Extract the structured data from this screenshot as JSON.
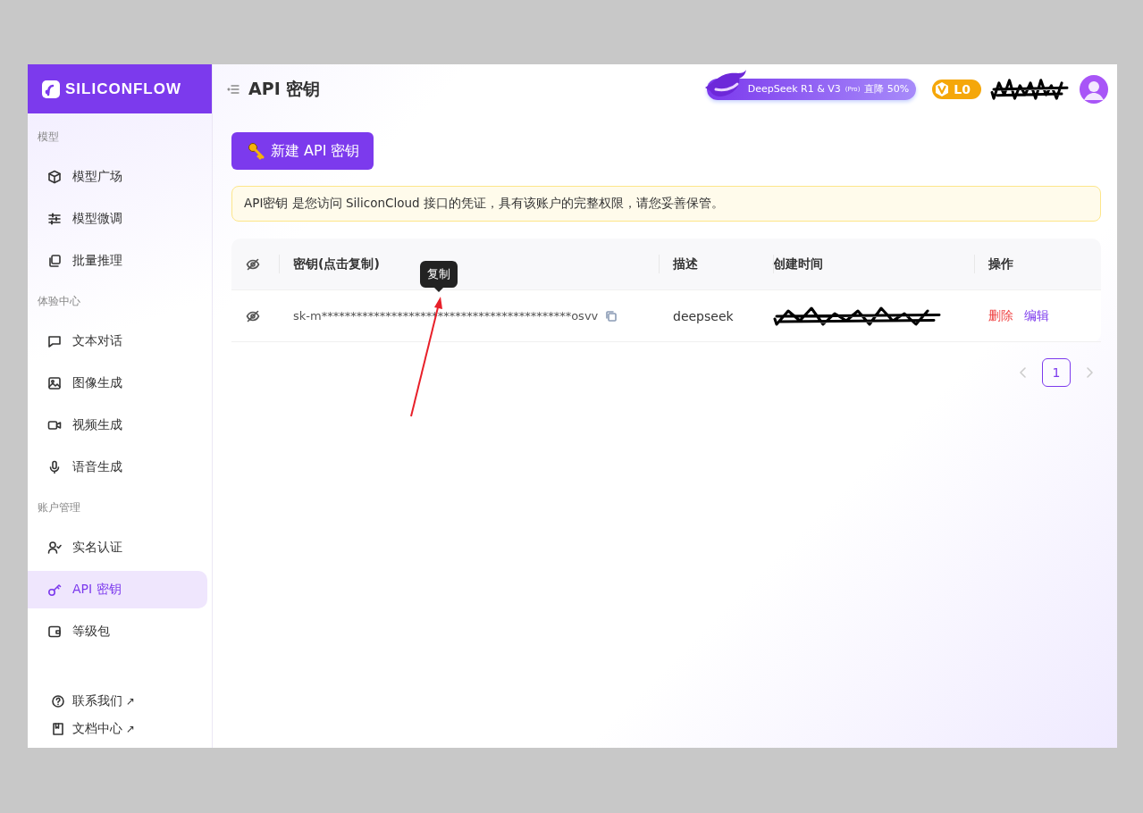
{
  "brand": {
    "name": "SILICONFLOW"
  },
  "sidebar": {
    "sections": [
      {
        "title": "模型",
        "items": [
          {
            "label": "模型广场",
            "selected": false
          },
          {
            "label": "模型微调",
            "selected": false
          },
          {
            "label": "批量推理",
            "selected": false
          }
        ]
      },
      {
        "title": "体验中心",
        "items": [
          {
            "label": "文本对话",
            "selected": false
          },
          {
            "label": "图像生成",
            "selected": false
          },
          {
            "label": "视频生成",
            "selected": false
          },
          {
            "label": "语音生成",
            "selected": false
          }
        ]
      },
      {
        "title": "账户管理",
        "items": [
          {
            "label": "实名认证",
            "selected": false
          },
          {
            "label": "API 密钥",
            "selected": true
          },
          {
            "label": "等级包",
            "selected": false
          }
        ]
      }
    ],
    "footer_links": [
      {
        "label": "联系我们",
        "arrow": "↗"
      },
      {
        "label": "文档中心",
        "arrow": "↗"
      }
    ]
  },
  "header": {
    "title": "API 密钥",
    "promo": {
      "text": "DeepSeek R1 & V3",
      "tag": "(Pro)",
      "offer": "直降 50%"
    },
    "level_badge": "L0"
  },
  "create_button": {
    "label": "新建 API 密钥"
  },
  "notice": "API密钥 是您访问 SiliconCloud 接口的凭证，具有该账户的完整权限，请您妥善保管。",
  "table": {
    "columns": [
      {
        "kind": "eye"
      },
      {
        "kind": "text",
        "label": "密钥(点击复制)"
      },
      {
        "kind": "text",
        "label": "描述"
      },
      {
        "kind": "text",
        "label": "创建时间"
      },
      {
        "kind": "text",
        "label": "操作"
      }
    ],
    "rows": [
      {
        "key": "sk-m*******************************************osvv",
        "description": "deepseek",
        "actions": [
          {
            "label": "删除",
            "kind": "danger"
          },
          {
            "label": "编辑",
            "kind": "primary"
          }
        ]
      }
    ]
  },
  "tooltip": "复制",
  "pagination": {
    "prev_disabled": true,
    "pages": [
      {
        "label": "1",
        "selected": true
      }
    ],
    "next_disabled": true
  }
}
